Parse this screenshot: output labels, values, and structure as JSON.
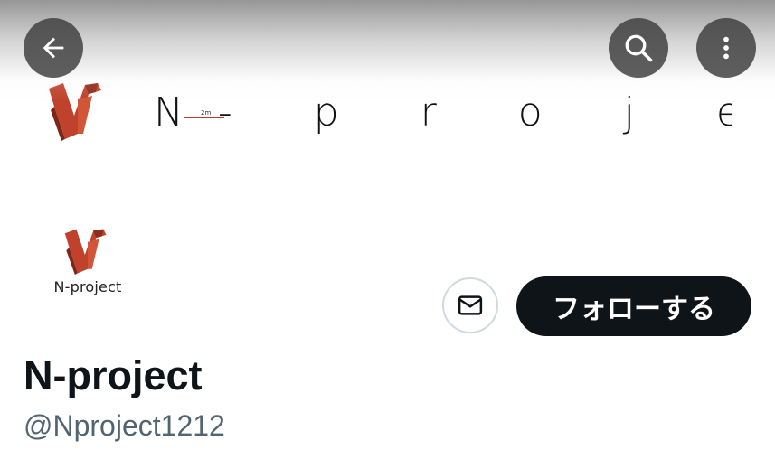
{
  "banner": {
    "title_text": "N- p r o j e c t",
    "sub_text": "2m"
  },
  "top_bar": {
    "back_icon": "arrow-left-icon",
    "search_icon": "search-icon",
    "more_icon": "more-vertical-icon"
  },
  "profile": {
    "avatar_label": "N-project",
    "display_name": "N-project",
    "handle": "@Nproject1212"
  },
  "actions": {
    "message_icon": "mail-icon",
    "follow_label": "フォローする"
  },
  "colors": {
    "brand_red": "#c0422c",
    "follow_button_bg": "#0f1419",
    "handle_gray": "#536471"
  }
}
